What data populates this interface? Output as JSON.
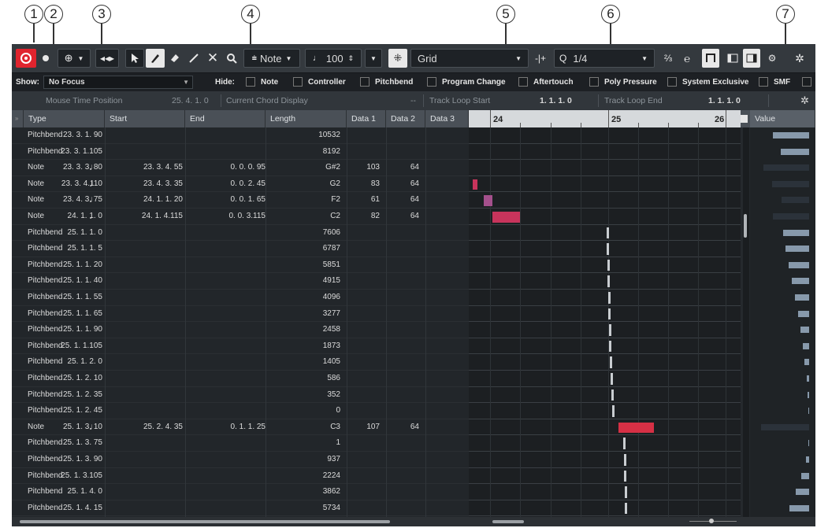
{
  "callouts": [
    "1",
    "2",
    "3",
    "4",
    "5",
    "6",
    "7"
  ],
  "toolbar": {
    "insert_type": "Note",
    "velocity": "100",
    "snap_type": "Grid",
    "quantize": "1/4",
    "icons": [
      "listen-icon",
      "record-icon",
      "auto-scroll-icon",
      "acoustic-feedback-icon",
      "pointer-icon",
      "pencil-icon",
      "eraser-icon",
      "line-icon",
      "mute-icon",
      "zoom-icon",
      "snap-icon",
      "quantize-icon",
      "swing-icon",
      "ai-quantize-icon",
      "window-layout-icon",
      "settings-icon"
    ]
  },
  "filter": {
    "show_label": "Show:",
    "focus_value": "No Focus",
    "hide_label": "Hide:",
    "options": [
      "Note",
      "Controller",
      "Pitchbend",
      "Program Change",
      "Aftertouch",
      "Poly Pressure",
      "System Exclusive",
      "SMF"
    ]
  },
  "info": {
    "mouse_label": "Mouse Time Position",
    "mouse_value": "25. 4. 1.  0",
    "chord_label": "Current Chord Display",
    "chord_value": "--",
    "loop_start_label": "Track Loop Start",
    "loop_start_value": "1. 1. 1.   0",
    "loop_end_label": "Track Loop End",
    "loop_end_value": "1. 1. 1.   0"
  },
  "columns": [
    "Type",
    "Start",
    "End",
    "Length",
    "Data 1",
    "Data 2",
    "Data 3"
  ],
  "value_header": "Value",
  "ruler_labels": [
    "24",
    "25",
    "26"
  ],
  "rows": [
    {
      "type": "Pitchbend",
      "note": false,
      "start": "23. 3. 1. 90",
      "end": "",
      "length": "",
      "d1": "10532",
      "d2": "",
      "d3": ""
    },
    {
      "type": "Pitchbend",
      "note": false,
      "start": "23. 3. 1.105",
      "end": "",
      "length": "",
      "d1": "8192",
      "d2": "",
      "d3": ""
    },
    {
      "type": "Note",
      "note": true,
      "start": "23. 3. 3. 80",
      "end": "23. 3. 4. 55",
      "length": "0. 0. 0. 95",
      "d1": "G#2",
      "d2": "103",
      "d3": "64"
    },
    {
      "type": "Note",
      "note": true,
      "start": "23. 3. 4.110",
      "end": "23. 4. 3. 35",
      "length": "0. 0. 2. 45",
      "d1": "G2",
      "d2": "83",
      "d3": "64"
    },
    {
      "type": "Note",
      "note": true,
      "start": "23. 4. 3. 75",
      "end": "24. 1. 1. 20",
      "length": "0. 0. 1. 65",
      "d1": "F2",
      "d2": "61",
      "d3": "64"
    },
    {
      "type": "Note",
      "note": true,
      "start": "24. 1. 1.  0",
      "end": "24. 1. 4.115",
      "length": "0. 0. 3.115",
      "d1": "C2",
      "d2": "82",
      "d3": "64"
    },
    {
      "type": "Pitchbend",
      "note": false,
      "start": "25. 1. 1.  0",
      "end": "",
      "length": "",
      "d1": "7606",
      "d2": "",
      "d3": ""
    },
    {
      "type": "Pitchbend",
      "note": false,
      "start": "25. 1. 1.  5",
      "end": "",
      "length": "",
      "d1": "6787",
      "d2": "",
      "d3": ""
    },
    {
      "type": "Pitchbend",
      "note": false,
      "start": "25. 1. 1. 20",
      "end": "",
      "length": "",
      "d1": "5851",
      "d2": "",
      "d3": ""
    },
    {
      "type": "Pitchbend",
      "note": false,
      "start": "25. 1. 1. 40",
      "end": "",
      "length": "",
      "d1": "4915",
      "d2": "",
      "d3": ""
    },
    {
      "type": "Pitchbend",
      "note": false,
      "start": "25. 1. 1. 55",
      "end": "",
      "length": "",
      "d1": "4096",
      "d2": "",
      "d3": ""
    },
    {
      "type": "Pitchbend",
      "note": false,
      "start": "25. 1. 1. 65",
      "end": "",
      "length": "",
      "d1": "3277",
      "d2": "",
      "d3": ""
    },
    {
      "type": "Pitchbend",
      "note": false,
      "start": "25. 1. 1. 90",
      "end": "",
      "length": "",
      "d1": "2458",
      "d2": "",
      "d3": ""
    },
    {
      "type": "Pitchbend",
      "note": false,
      "start": "25. 1. 1.105",
      "end": "",
      "length": "",
      "d1": "1873",
      "d2": "",
      "d3": ""
    },
    {
      "type": "Pitchbend",
      "note": false,
      "start": "25. 1. 2.  0",
      "end": "",
      "length": "",
      "d1": "1405",
      "d2": "",
      "d3": ""
    },
    {
      "type": "Pitchbend",
      "note": false,
      "start": "25. 1. 2. 10",
      "end": "",
      "length": "",
      "d1": "586",
      "d2": "",
      "d3": ""
    },
    {
      "type": "Pitchbend",
      "note": false,
      "start": "25. 1. 2. 35",
      "end": "",
      "length": "",
      "d1": "352",
      "d2": "",
      "d3": ""
    },
    {
      "type": "Pitchbend",
      "note": false,
      "start": "25. 1. 2. 45",
      "end": "",
      "length": "",
      "d1": "0",
      "d2": "",
      "d3": ""
    },
    {
      "type": "Note",
      "note": true,
      "start": "25. 1. 3. 10",
      "end": "25. 2. 4. 35",
      "length": "0. 1. 1. 25",
      "d1": "C3",
      "d2": "107",
      "d3": "64"
    },
    {
      "type": "Pitchbend",
      "note": false,
      "start": "25. 1. 3. 75",
      "end": "",
      "length": "",
      "d1": "1",
      "d2": "",
      "d3": ""
    },
    {
      "type": "Pitchbend",
      "note": false,
      "start": "25. 1. 3. 90",
      "end": "",
      "length": "",
      "d1": "937",
      "d2": "",
      "d3": ""
    },
    {
      "type": "Pitchbend",
      "note": false,
      "start": "25. 1. 3.105",
      "end": "",
      "length": "",
      "d1": "2224",
      "d2": "",
      "d3": ""
    },
    {
      "type": "Pitchbend",
      "note": false,
      "start": "25. 1. 4.  0",
      "end": "",
      "length": "",
      "d1": "3862",
      "d2": "",
      "d3": ""
    },
    {
      "type": "Pitchbend",
      "note": false,
      "start": "25. 1. 4. 15",
      "end": "",
      "length": "",
      "d1": "5734",
      "d2": "",
      "d3": ""
    }
  ],
  "colors": {
    "note_bar": "#c8345c",
    "note_bar_selected": "#d63045",
    "pitch_marker": "#c9cdd1",
    "value_bar": "#8799ab",
    "record_red": "#e0242e"
  }
}
